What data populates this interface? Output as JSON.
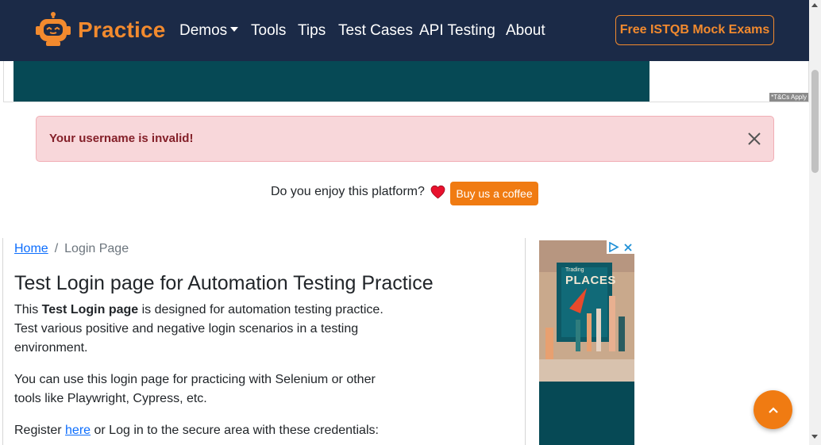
{
  "navbar": {
    "brand": "Practice",
    "items": [
      {
        "label": "Demos",
        "has_caret": true
      },
      {
        "label": "Tools"
      },
      {
        "label": "Tips"
      },
      {
        "label": "Test Cases"
      },
      {
        "label": "API Testing"
      },
      {
        "label": "About"
      }
    ],
    "cta": "Free ISTQB Mock Exams",
    "bg_color": "#1b2a47",
    "accent_color": "#f28a2e"
  },
  "ad_banner": {
    "tcs": "*T&Cs Apply"
  },
  "alert": {
    "message": "Your username is invalid!"
  },
  "coffee": {
    "question": "Do you enjoy this platform?",
    "button": "Buy us a coffee"
  },
  "breadcrumb": {
    "home": "Home",
    "separator": "/",
    "current": "Login Page"
  },
  "main": {
    "title": "Test Login page for Automation Testing Practice",
    "intro_prefix": "This ",
    "intro_bold": "Test Login page",
    "intro_suffix": " is designed for automation testing practice. Test various positive and negative login scenarios in a testing environment.",
    "para2": "You can use this login page for practicing with Selenium or other tools like Playwright, Cypress, etc.",
    "register_prefix": "Register ",
    "register_link": "here",
    "register_suffix": " or Log in to the secure area with these credentials:"
  },
  "side_ad": {
    "headline": "PLACES",
    "kicker": "Trading"
  }
}
